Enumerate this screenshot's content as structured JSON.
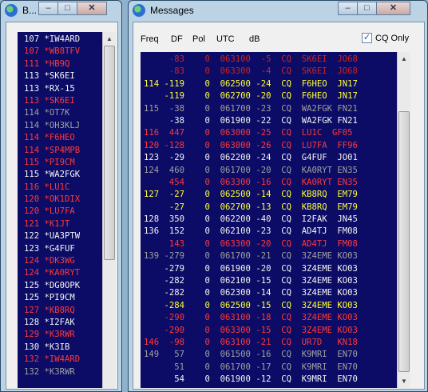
{
  "band_window": {
    "title": "B...",
    "icon": "globe-icon",
    "minimize_label": "–",
    "maximize_label": "□",
    "close_label": "✕",
    "rows": [
      {
        "num": "107",
        "call": "*IW4ARD",
        "color": "white"
      },
      {
        "num": "107",
        "call": "*WB8TFV",
        "color": "red"
      },
      {
        "num": "111",
        "call": "*HB9Q",
        "color": "red"
      },
      {
        "num": "113",
        "call": "*SK6EI",
        "color": "white"
      },
      {
        "num": "113",
        "call": "*RX-15",
        "color": "white"
      },
      {
        "num": "113",
        "call": "*SK6EI",
        "color": "red"
      },
      {
        "num": "114",
        "call": "*OT7K",
        "color": "gray"
      },
      {
        "num": "114",
        "call": "*OH3KLJ",
        "color": "gray"
      },
      {
        "num": "114",
        "call": "*F6HEO",
        "color": "red"
      },
      {
        "num": "114",
        "call": "*SP4MPB",
        "color": "red"
      },
      {
        "num": "115",
        "call": "*PI9CM",
        "color": "red"
      },
      {
        "num": "115",
        "call": "*WA2FGK",
        "color": "white"
      },
      {
        "num": "116",
        "call": "*LU1C",
        "color": "red"
      },
      {
        "num": "120",
        "call": "*OK1DIX",
        "color": "red"
      },
      {
        "num": "120",
        "call": "*LU7FA",
        "color": "red"
      },
      {
        "num": "121",
        "call": "*K1JT",
        "color": "red"
      },
      {
        "num": "122",
        "call": "*UA3PTW",
        "color": "white"
      },
      {
        "num": "123",
        "call": "*G4FUF",
        "color": "white"
      },
      {
        "num": "124",
        "call": "*DK3WG",
        "color": "red"
      },
      {
        "num": "124",
        "call": "*KA0RYT",
        "color": "red"
      },
      {
        "num": "125",
        "call": "*DG0OPK",
        "color": "white"
      },
      {
        "num": "125",
        "call": "*PI9CM",
        "color": "white"
      },
      {
        "num": "127",
        "call": "*KB8RQ",
        "color": "red"
      },
      {
        "num": "128",
        "call": "*I2FAK",
        "color": "white"
      },
      {
        "num": "129",
        "call": "*K3RWR",
        "color": "red"
      },
      {
        "num": "130",
        "call": "*K3IB",
        "color": "white"
      },
      {
        "num": "132",
        "call": "*IW4ARD",
        "color": "red"
      },
      {
        "num": "132",
        "call": "*K3RWR",
        "color": "gray"
      }
    ]
  },
  "messages_window": {
    "title": "Messages",
    "icon": "globe-icon",
    "minimize_label": "–",
    "maximize_label": "□",
    "close_label": "✕",
    "columns": {
      "freq": "Freq",
      "df": "DF",
      "pol": "Pol",
      "utc": "UTC",
      "db": "dB"
    },
    "cq_only_label": "CQ Only",
    "cq_only_checked": "✓",
    "rows": [
      {
        "text": "     -83    0  063100  -5  CQ  SK6EI  JO68",
        "color": "dim"
      },
      {
        "text": "     -83    0  063300  -4  CQ  SK6EI  JO68",
        "color": "dim"
      },
      {
        "text": "114 -119    0  062500 -24  CQ  F6HEO  JN17",
        "color": "yellow"
      },
      {
        "text": "    -119    0  062700 -20  CQ  F6HEO  JN17",
        "color": "yellow"
      },
      {
        "text": "115  -38    0  061700 -23  CQ  WA2FGK FN21",
        "color": "gray"
      },
      {
        "text": "     -38    0  061900 -22  CQ  WA2FGK FN21",
        "color": "white"
      },
      {
        "text": "116  447    0  063000 -25  CQ  LU1C  GF05",
        "color": "red"
      },
      {
        "text": "120 -128    0  063000 -26  CQ  LU7FA  FF96",
        "color": "red"
      },
      {
        "text": "123  -29    0  062200 -24  CQ  G4FUF  JO01",
        "color": "white"
      },
      {
        "text": "124  460    0  061700 -20  CQ  KA0RYT EN35",
        "color": "gray"
      },
      {
        "text": "     454    0  063300 -16  CQ  KA0RYT EN35",
        "color": "red"
      },
      {
        "text": "127  -27    0  062500 -14  CQ  KB8RQ  EM79",
        "color": "yellow"
      },
      {
        "text": "     -27    0  062700 -13  CQ  KB8RQ  EM79",
        "color": "yellow"
      },
      {
        "text": "128  350    0  062200 -40  CQ  I2FAK  JN45",
        "color": "white"
      },
      {
        "text": "136  152    0  062100 -23  CQ  AD4TJ  FM08",
        "color": "white"
      },
      {
        "text": "     143    0  063300 -20  CQ  AD4TJ  FM08",
        "color": "red"
      },
      {
        "text": "139 -279    0  061700 -21  CQ  3Z4EME KO03",
        "color": "gray"
      },
      {
        "text": "    -279    0  061900 -20  CQ  3Z4EME KO03",
        "color": "white"
      },
      {
        "text": "    -282    0  062100 -15  CQ  3Z4EME KO03",
        "color": "white"
      },
      {
        "text": "    -282    0  062300 -14  CQ  3Z4EME KO03",
        "color": "white"
      },
      {
        "text": "    -284    0  062500 -15  CQ  3Z4EME KO03",
        "color": "yellow"
      },
      {
        "text": "    -290    0  063100 -18  CQ  3Z4EME KO03",
        "color": "red"
      },
      {
        "text": "    -290    0  063300 -15  CQ  3Z4EME KO03",
        "color": "red"
      },
      {
        "text": "146  -98    0  063100 -21  CQ  UR7D   KN18",
        "color": "red"
      },
      {
        "text": "149   57    0  061500 -16  CQ  K9MRI  EN70",
        "color": "gray"
      },
      {
        "text": "      51    0  061700 -17  CQ  K9MRI  EN70",
        "color": "gray"
      },
      {
        "text": "      54    0  061900 -12  CQ  K9MRI  EN70",
        "color": "white"
      }
    ]
  }
}
